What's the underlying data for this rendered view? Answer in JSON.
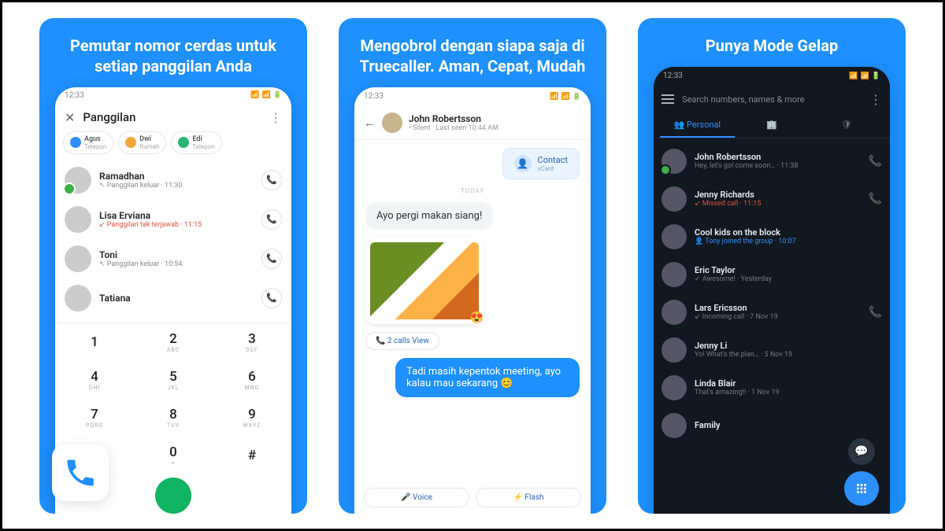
{
  "panels": [
    {
      "headline": "Pemutar nomor cerdas untuk setiap panggilan Anda"
    },
    {
      "headline": "Mengobrol dengan siapa saja di Truecaller. Aman, Cepat, Mudah"
    },
    {
      "headline": "Punya Mode Gelap"
    }
  ],
  "clock": "12:33",
  "panel1": {
    "title": "Panggilan",
    "chips": [
      {
        "name": "Agus",
        "label": "Telepon",
        "color": "#2e90ff"
      },
      {
        "name": "Dwi",
        "label": "Rumah",
        "color": "#f2a93b"
      },
      {
        "name": "Edi",
        "label": "Telepon",
        "color": "#2bb673"
      }
    ],
    "rows": [
      {
        "name": "Ramadhan",
        "sub": "↖ Panggilan keluar · 11:30",
        "miss": false,
        "online": true
      },
      {
        "name": "Lisa Erviana",
        "sub": "↙ Panggilan tak terjawab · 11:15",
        "miss": true,
        "online": false
      },
      {
        "name": "Toni",
        "sub": "↖ Panggilan keluar · 10:54",
        "miss": false,
        "online": false
      },
      {
        "name": "Tatiana",
        "sub": "",
        "miss": false,
        "online": false
      }
    ],
    "keys": [
      {
        "n": "1",
        "l": ""
      },
      {
        "n": "2",
        "l": "ABC"
      },
      {
        "n": "3",
        "l": "DEF"
      },
      {
        "n": "4",
        "l": "GHI"
      },
      {
        "n": "5",
        "l": "JKL"
      },
      {
        "n": "6",
        "l": "MNO"
      },
      {
        "n": "7",
        "l": "PQRS"
      },
      {
        "n": "8",
        "l": "TUV"
      },
      {
        "n": "9",
        "l": "WXYZ"
      },
      {
        "n": "*",
        "l": ""
      },
      {
        "n": "0",
        "l": "+"
      },
      {
        "n": "#",
        "l": ""
      }
    ]
  },
  "panel2": {
    "name": "John Robertsson",
    "status": "• Silent · Last seen 10:44 AM",
    "contact_card": "Contact",
    "contact_sub": "vCard",
    "day": "TODAY",
    "msg_in": "Ayo pergi makan siang!",
    "call_chip": "📞  2 calls   View",
    "msg_out": "Tadi masih kepentok meeting, ayo kalau mau sekarang 😊",
    "voice": "🎤  Voice",
    "flash": "⚡  Flash"
  },
  "panel3": {
    "search": "Search numbers, names & more",
    "tab_personal": "👥 Personal",
    "rows": [
      {
        "name": "John Robertsson",
        "sub": "Hey, let's go! come soon… · 11:38",
        "phone": true,
        "on": true
      },
      {
        "name": "Jenny Richards",
        "sub": "↙ Missed call · 11:15",
        "phone": true,
        "miss": true
      },
      {
        "name": "Cool kids on the block",
        "sub": "👤 Tony joined the group · 10:07",
        "grp": true
      },
      {
        "name": "Eric Taylor",
        "sub": "✓ Awesome! · Yesterday"
      },
      {
        "name": "Lars Ericsson",
        "sub": "↙ Incoming call · 7 Nov 19",
        "phone": true
      },
      {
        "name": "Jenny Li",
        "sub": "Yo! What's the plan… · 5 Nov 19"
      },
      {
        "name": "Linda Blair",
        "sub": "That's amazing!! · 1 Nov 19"
      },
      {
        "name": "Family",
        "sub": ""
      }
    ]
  }
}
